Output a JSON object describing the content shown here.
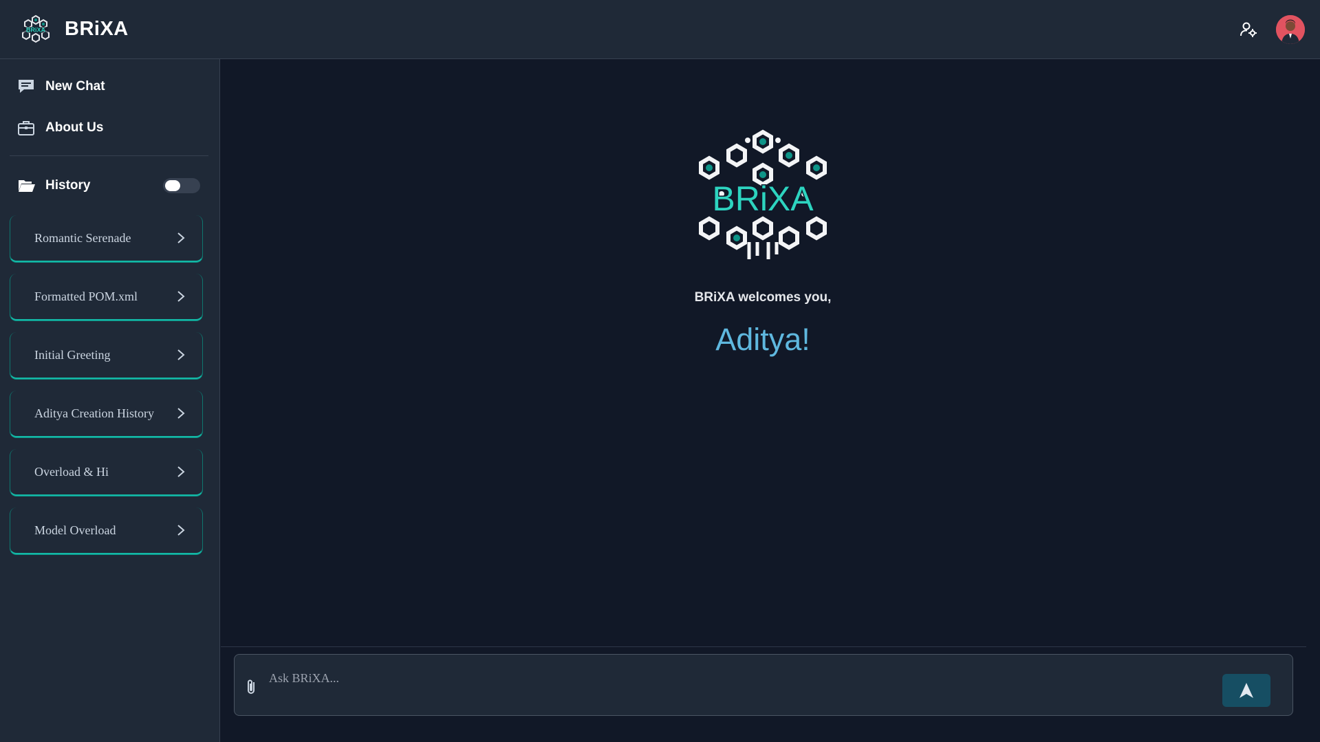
{
  "app": {
    "name": "BRiXA"
  },
  "header": {
    "settings_icon": "user-settings-icon",
    "avatar_icon": "user-avatar"
  },
  "sidebar": {
    "nav": [
      {
        "label": "New Chat",
        "icon": "chat-icon"
      },
      {
        "label": "About Us",
        "icon": "briefcase-icon"
      }
    ],
    "history": {
      "label": "History",
      "icon": "folder-open-icon",
      "toggle_on": false,
      "items": [
        {
          "label": "Romantic Serenade"
        },
        {
          "label": "Formatted POM.xml"
        },
        {
          "label": "Initial Greeting"
        },
        {
          "label": "Aditya Creation History"
        },
        {
          "label": "Overload & Hi"
        },
        {
          "label": "Model Overload"
        }
      ]
    }
  },
  "main": {
    "logo_text": "BRiXA",
    "welcome": "BRiXA welcomes you,",
    "user_name": "Aditya!"
  },
  "composer": {
    "placeholder": "Ask BRiXA...",
    "value": ""
  },
  "colors": {
    "background": "#111827",
    "panel": "#1f2937",
    "accent": "#14b8a6",
    "name_color": "#5fb8df",
    "send_button": "#164e63"
  }
}
